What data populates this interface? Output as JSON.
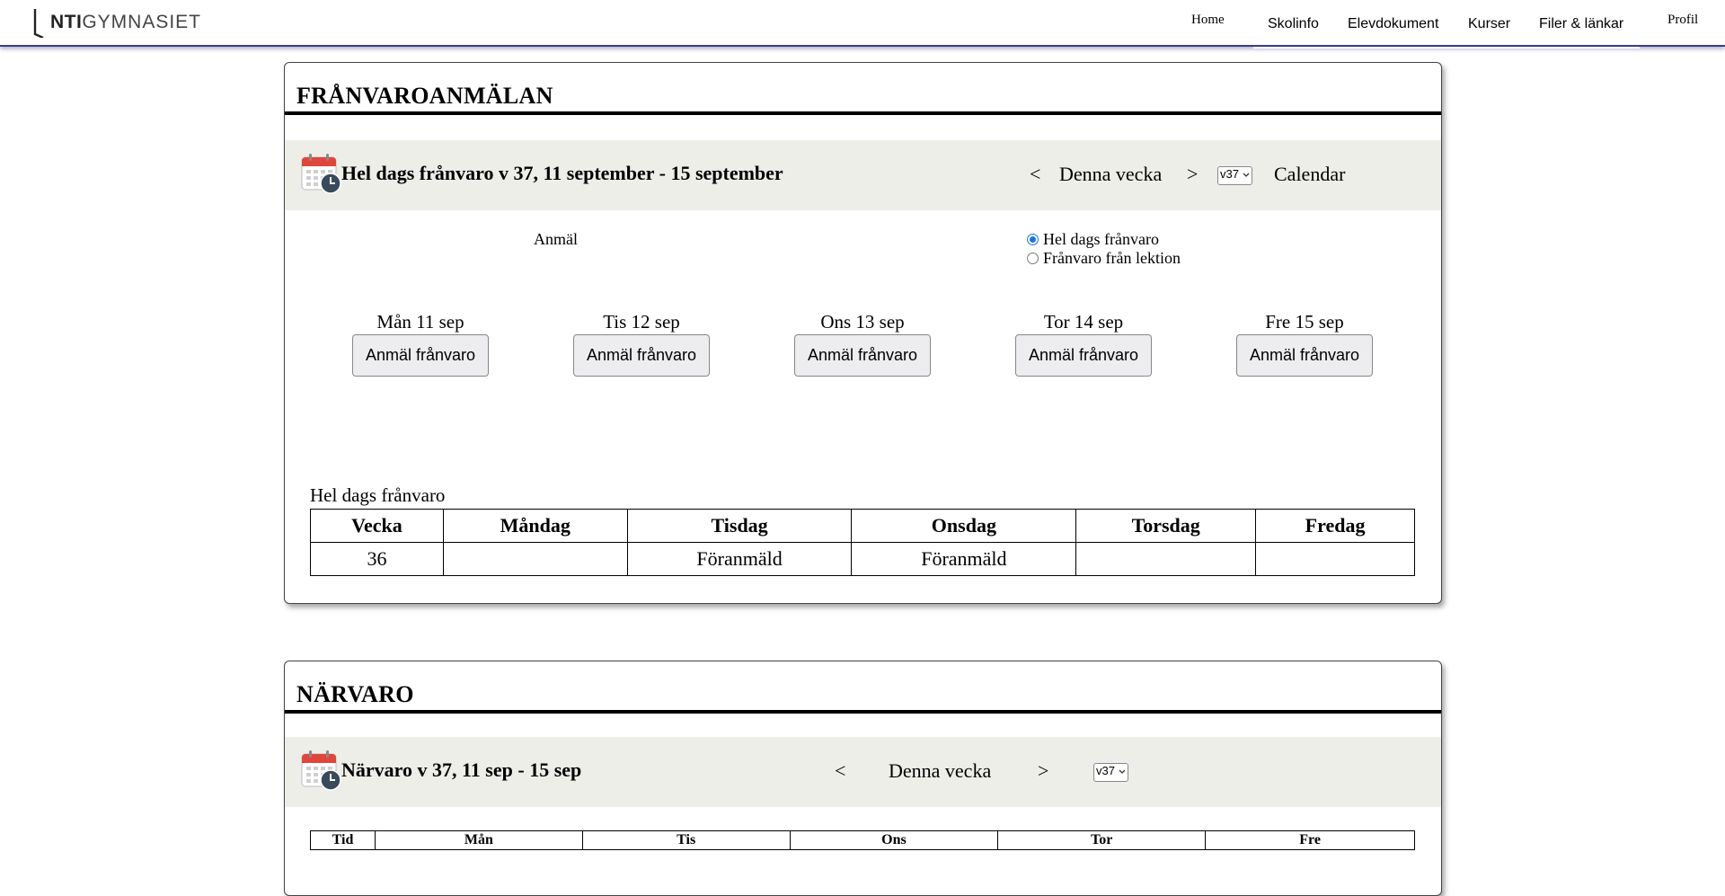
{
  "nav": {
    "logo_bold": "NTI",
    "logo_light": "GYMNASIET",
    "home": "Home",
    "skolinfo": "Skolinfo",
    "elevdokument": "Elevdokument",
    "kurser": "Kurser",
    "filer": "Filer & länkar",
    "profil": "Profil"
  },
  "absence": {
    "title": "FRÅNVAROANMÄLAN",
    "bar_title": "Hel dags frånvaro v 37, 11 september - 15 september",
    "prev": "<",
    "this_week": "Denna vecka",
    "next": ">",
    "week_select": "v37",
    "calendar": "Calendar",
    "report_label": "Anmäl",
    "options": [
      {
        "label": "Hel dags frånvaro",
        "selected": true
      },
      {
        "label": "Frånvaro från lektion",
        "selected": false
      }
    ],
    "days": [
      {
        "label": "Mån 11 sep",
        "button": "Anmäl frånvaro"
      },
      {
        "label": "Tis 12 sep",
        "button": "Anmäl frånvaro"
      },
      {
        "label": "Ons 13 sep",
        "button": "Anmäl frånvaro"
      },
      {
        "label": "Tor 14 sep",
        "button": "Anmäl frånvaro"
      },
      {
        "label": "Fre 15 sep",
        "button": "Anmäl frånvaro"
      }
    ],
    "table_caption": "Hel dags frånvaro",
    "table_headers": [
      "Vecka",
      "Måndag",
      "Tisdag",
      "Onsdag",
      "Torsdag",
      "Fredag"
    ],
    "table_rows": [
      [
        "36",
        "",
        "Föranmäld",
        "Föranmäld",
        "",
        ""
      ]
    ]
  },
  "attendance": {
    "title": "NÄRVARO",
    "bar_title": "Närvaro v 37, 11 sep - 15 sep",
    "prev": "<",
    "this_week": "Denna vecka",
    "next": ">",
    "week_select": "v37",
    "table_headers": [
      "Tid",
      "Mån",
      "Tis",
      "Ons",
      "Tor",
      "Fre"
    ]
  },
  "colors": {
    "nav_border": "#3b3b8c",
    "bar_background": "#eeeee8",
    "radio_selected": "#1a73e8",
    "calendar_icon_red": "#e0463c"
  }
}
